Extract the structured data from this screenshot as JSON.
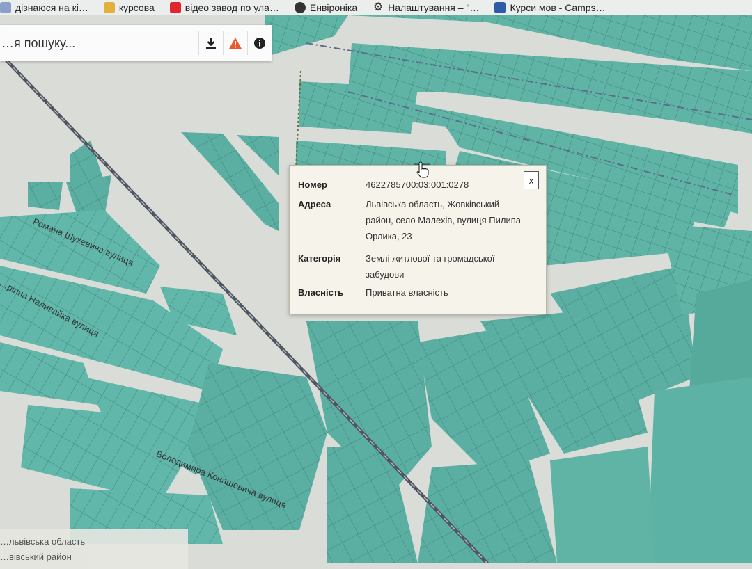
{
  "bookmarks": [
    {
      "label": "дізнаюся на кі…",
      "icon": "bookmark-icon",
      "color": "#8aa0c8"
    },
    {
      "label": "курсова",
      "icon": "folder-icon",
      "color": "#e2b13c"
    },
    {
      "label": "відео завод по ула…",
      "icon": "youtube-icon",
      "color": "#e0262a"
    },
    {
      "label": "Енвіроніка",
      "icon": "globe-icon",
      "color": "#333333"
    },
    {
      "label": "Налаштування – \"…",
      "icon": "gear-icon",
      "color": "#333333"
    },
    {
      "label": "Курси мов - Camps…",
      "icon": "camps-icon",
      "color": "#2e5aa8"
    }
  ],
  "search": {
    "placeholder": "…я пошуку..."
  },
  "toolbar": {
    "download": "download-icon",
    "warning": "warning-icon",
    "info": "info-icon"
  },
  "popup": {
    "rows": [
      {
        "key": "Номер",
        "value": "4622785700:03:001:0278"
      },
      {
        "key": "Адреса",
        "value": "Львівська область, Жовківський район, село Малехів, вулиця Пилипа Орлика, 23"
      },
      {
        "key": "Категорія",
        "value": "Землі житлової та громадської забудови"
      },
      {
        "key": "Власність",
        "value": "Приватна власність"
      }
    ],
    "close_label": "x"
  },
  "streets": [
    {
      "name": "Романа Шухевича вулиця"
    },
    {
      "name": "…ріпна Наливайка вулиця"
    },
    {
      "name": "Володимира Конашевича вулиця"
    }
  ],
  "region_labels": {
    "oblast": "…львівська область",
    "raion": "…вівський район"
  },
  "colors": {
    "parcel": "#5fb4a6",
    "parcel_border": "#3f8478",
    "road": "#dfe1dc",
    "accent": "#f0a000"
  }
}
